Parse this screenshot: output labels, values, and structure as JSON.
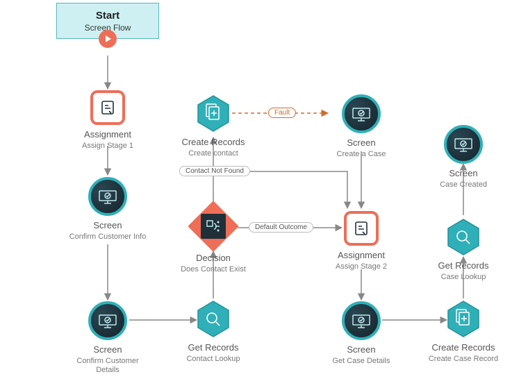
{
  "diagram": {
    "start": {
      "title": "Start",
      "subtitle": "Screen Flow"
    },
    "nodes": {
      "assign1": {
        "title": "Assignment",
        "subtitle": "Assign Stage 1"
      },
      "screen_confirm_info": {
        "title": "Screen",
        "subtitle": "Confirm Customer Info"
      },
      "screen_confirm_details": {
        "title": "Screen",
        "subtitle": "Confirm Customer Details"
      },
      "get_contact": {
        "title": "Get Records",
        "subtitle": "Contact Lookup"
      },
      "decision": {
        "title": "Decision",
        "subtitle": "Does Contact Exist"
      },
      "create_contact": {
        "title": "Create Records",
        "subtitle": "Create contact"
      },
      "screen_create_case": {
        "title": "Screen",
        "subtitle": "Create a Case"
      },
      "assign2": {
        "title": "Assignment",
        "subtitle": "Assign Stage 2"
      },
      "screen_get_case": {
        "title": "Screen",
        "subtitle": "Get Case Details"
      },
      "create_case": {
        "title": "Create Records",
        "subtitle": "Create Case Record"
      },
      "get_case": {
        "title": "Get Records",
        "subtitle": "Case Lookup"
      },
      "screen_case_created": {
        "title": "Screen",
        "subtitle": "Case Created"
      }
    },
    "labels": {
      "fault": "Fault",
      "contact_not_found": "Contact Not Found",
      "default_outcome": "Default Outcome"
    }
  }
}
